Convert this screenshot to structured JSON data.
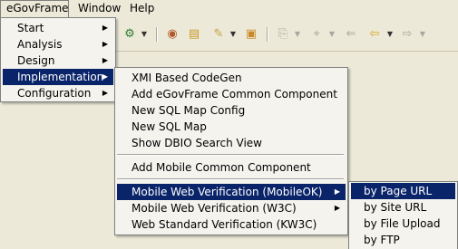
{
  "menubar": {
    "items": [
      {
        "label": "eGovFrame"
      },
      {
        "label": "Window"
      },
      {
        "label": "Help"
      }
    ]
  },
  "toolbar": {
    "icons": [
      "gear-icon",
      "db-connect-icon",
      "open-folder-icon",
      "pen-icon",
      "folder-open-icon",
      "paste-icon",
      "pin-icon",
      "back-arrow-icon",
      "prev-annotation-icon",
      "forward-arrow-icon"
    ]
  },
  "egov_menu": {
    "items": [
      {
        "label": "Start",
        "submenu": true
      },
      {
        "label": "Analysis",
        "submenu": true
      },
      {
        "label": "Design",
        "submenu": true
      },
      {
        "label": "Implementation",
        "submenu": true,
        "highlighted": true
      },
      {
        "label": "Configuration",
        "submenu": true
      }
    ]
  },
  "implementation_menu": {
    "group1": [
      {
        "label": "XMI Based CodeGen"
      },
      {
        "label": "Add eGovFrame Common Component"
      },
      {
        "label": "New SQL Map Config"
      },
      {
        "label": "New SQL Map"
      },
      {
        "label": "Show DBIO Search View"
      }
    ],
    "group2": [
      {
        "label": "Add Mobile Common Component"
      }
    ],
    "group3": [
      {
        "label": "Mobile Web Verification (MobileOK)",
        "submenu": true,
        "highlighted": true
      },
      {
        "label": "Mobile Web Verification (W3C)",
        "submenu": true
      },
      {
        "label": "Web Standard Verification (KW3C)"
      }
    ]
  },
  "verification_menu": {
    "items": [
      {
        "label": "by Page URL",
        "highlighted": true
      },
      {
        "label": "by Site URL"
      },
      {
        "label": "by File Upload"
      },
      {
        "label": "by FTP"
      }
    ]
  },
  "submenu_arrow": "▶"
}
